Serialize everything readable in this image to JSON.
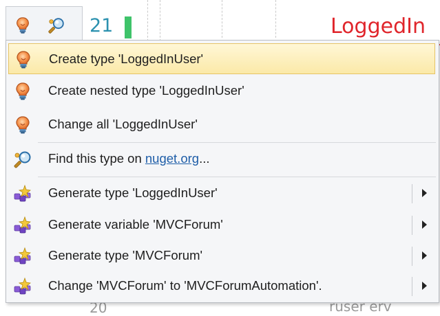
{
  "editor": {
    "line_number": "21",
    "code_token": "LoggedIn",
    "bottom_line_number": "20",
    "bottom_code": "ruser erv"
  },
  "menu": {
    "items": [
      {
        "label": "Create type 'LoggedInUser'",
        "icon": "bulb-icon",
        "highlighted": true
      },
      {
        "label": "Create nested type 'LoggedInUser'",
        "icon": "bulb-icon"
      },
      {
        "label": "Change all 'LoggedInUser'",
        "icon": "bulb-icon"
      },
      {
        "label_prefix": "Find this type on ",
        "link": "nuget.org",
        "label_suffix": "...",
        "icon": "nuget-search-icon"
      },
      {
        "label": "Generate type 'LoggedInUser'",
        "icon": "generate-icon",
        "submenu": true
      },
      {
        "label": "Generate variable 'MVCForum'",
        "icon": "generate-icon",
        "submenu": true
      },
      {
        "label": "Generate type 'MVCForum'",
        "icon": "generate-icon",
        "submenu": true
      },
      {
        "label": "Change 'MVCForum' to 'MVCForumAutomation'.",
        "icon": "generate-icon",
        "submenu": true
      }
    ]
  },
  "colors": {
    "highlight": "#fbe9a8",
    "error_text": "#e0252b",
    "link": "#1f5ea8",
    "line_number": "#2b91af"
  }
}
